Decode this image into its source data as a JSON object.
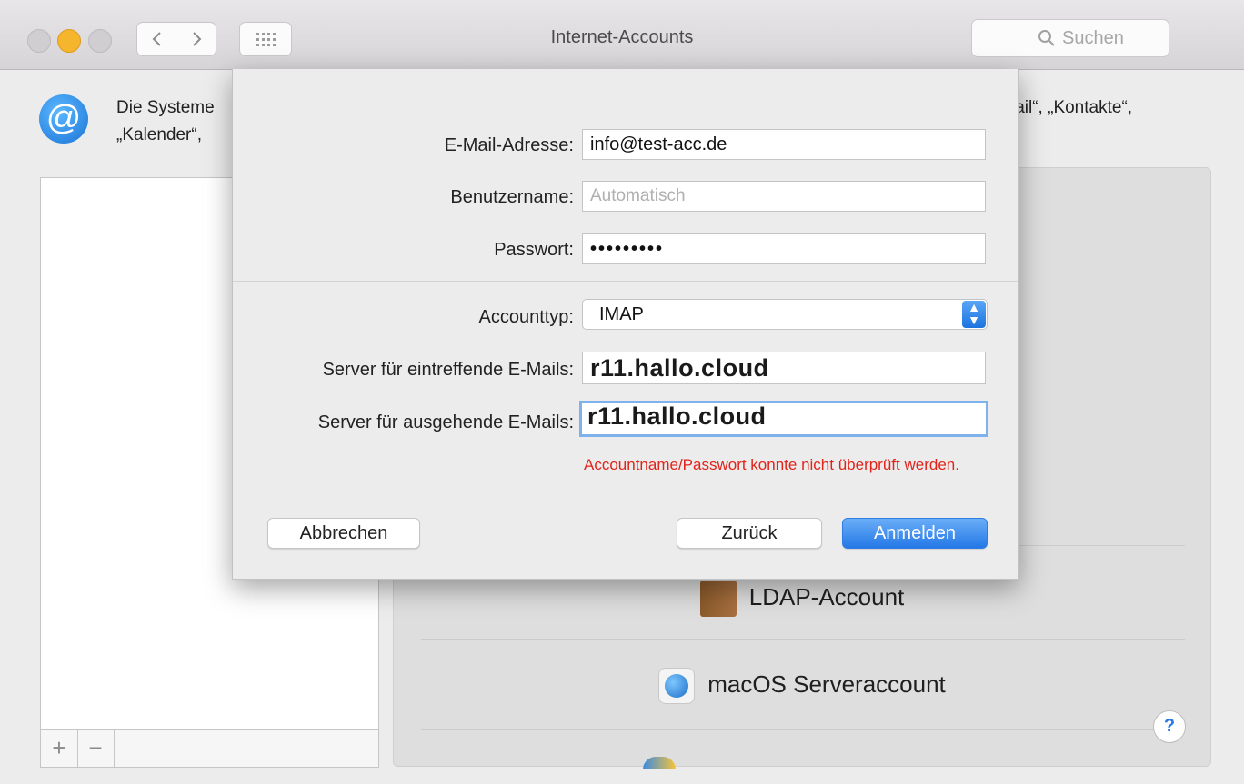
{
  "window": {
    "title": "Internet-Accounts",
    "search_placeholder": "Suchen"
  },
  "background": {
    "description_line1": "Die Systeme",
    "description_line2": "„Kalender“,",
    "description_right": "lail“, „Kontakte“,",
    "list_add": "+",
    "list_remove": "−",
    "providers": [
      {
        "label": "LDAP-Account",
        "icon": "ldap-icon"
      },
      {
        "label": "macOS Serveraccount",
        "icon": "globe-icon"
      }
    ],
    "help": "?"
  },
  "sheet": {
    "email_label": "E-Mail-Adresse:",
    "email_value": "info@test-acc.de",
    "username_label": "Benutzername:",
    "username_placeholder": "Automatisch",
    "password_label": "Passwort:",
    "password_value": "•••••••••",
    "account_type_label": "Accounttyp:",
    "account_type_value": "IMAP",
    "incoming_label": "Server für eintreffende E-Mails:",
    "incoming_value": "r11.hallo.cloud",
    "outgoing_label": "Server für ausgehende E-Mails:",
    "outgoing_value": "r11.hallo.cloud",
    "error_text": "Accountname/Passwort konnte nicht überprüft werden.",
    "cancel_label": "Abbrechen",
    "back_label": "Zurück",
    "signin_label": "Anmelden"
  },
  "colors": {
    "accent": "#2478e6",
    "error": "#e2231a",
    "minimize": "#f5b62e"
  }
}
